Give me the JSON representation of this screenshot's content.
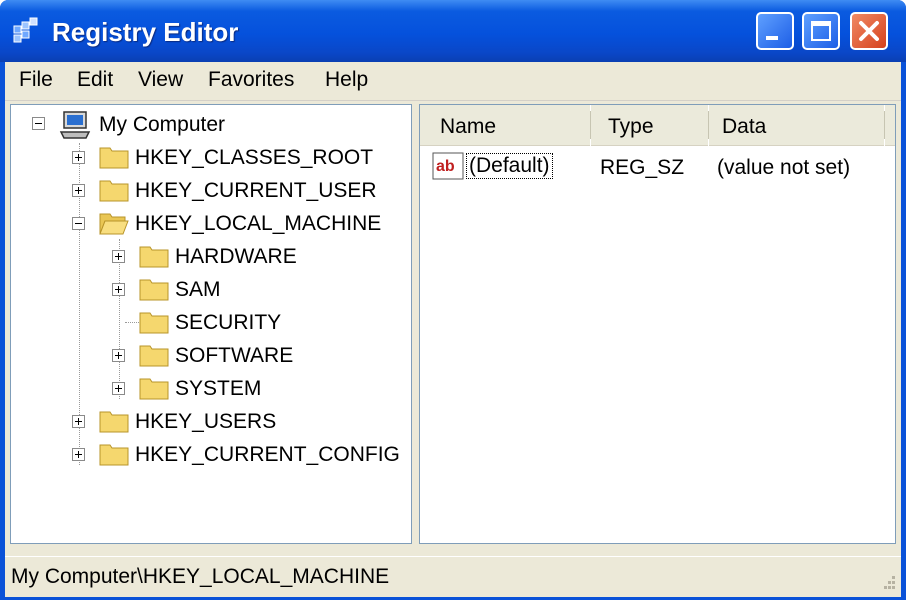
{
  "window": {
    "title": "Registry Editor"
  },
  "menu": [
    "File",
    "Edit",
    "View",
    "Favorites",
    "Help"
  ],
  "tree": {
    "root": "My Computer",
    "hives": [
      {
        "label": "HKEY_CLASSES_ROOT",
        "state": "collapsed"
      },
      {
        "label": "HKEY_CURRENT_USER",
        "state": "collapsed"
      },
      {
        "label": "HKEY_LOCAL_MACHINE",
        "state": "expanded",
        "children": [
          {
            "label": "HARDWARE",
            "state": "collapsed"
          },
          {
            "label": "SAM",
            "state": "collapsed"
          },
          {
            "label": "SECURITY",
            "state": "leaf"
          },
          {
            "label": "SOFTWARE",
            "state": "collapsed"
          },
          {
            "label": "SYSTEM",
            "state": "collapsed"
          }
        ]
      },
      {
        "label": "HKEY_USERS",
        "state": "collapsed"
      },
      {
        "label": "HKEY_CURRENT_CONFIG",
        "state": "collapsed"
      }
    ]
  },
  "list": {
    "columns": [
      "Name",
      "Type",
      "Data"
    ],
    "rows": [
      {
        "icon": "string-value-icon",
        "icon_text": "ab",
        "name": "(Default)",
        "type": "REG_SZ",
        "data": "(value not set)"
      }
    ]
  },
  "status": {
    "path": "My Computer\\HKEY_LOCAL_MACHINE"
  },
  "colors": {
    "title_bar": "#0551dc",
    "close_button": "#d6411c",
    "window_face": "#ece9d8",
    "folder_yellow": "#f5d76e"
  }
}
